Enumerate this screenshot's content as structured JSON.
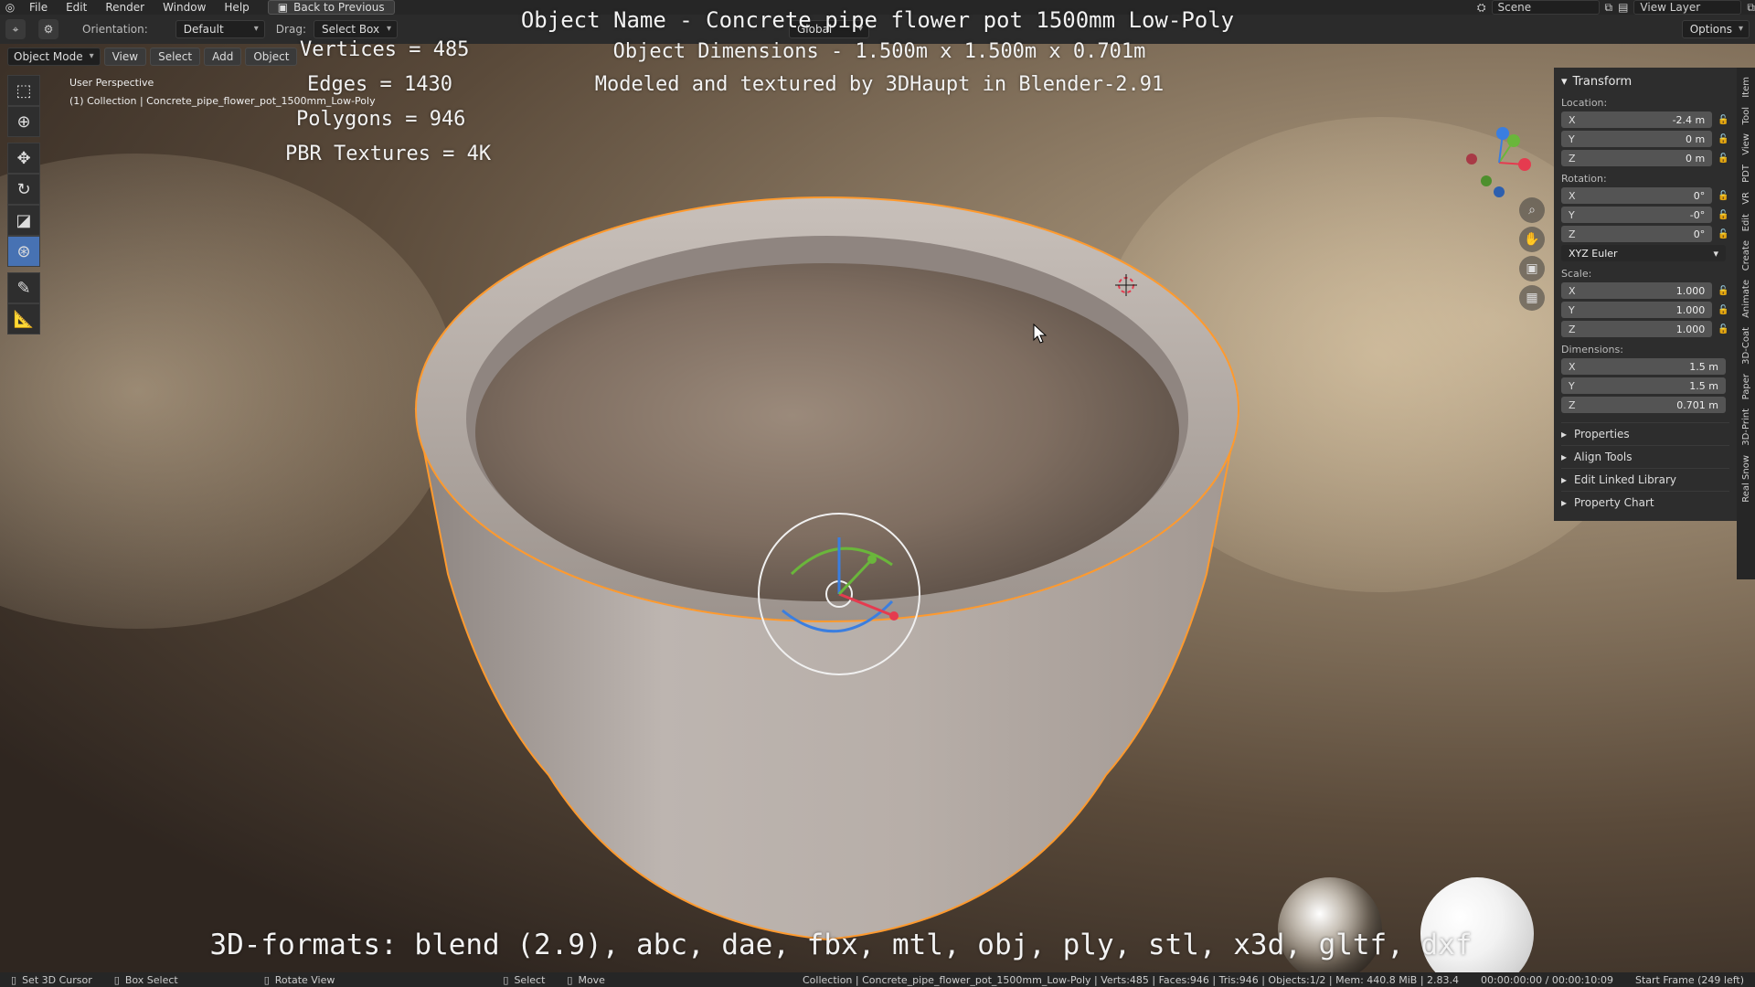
{
  "app": {
    "menu": [
      "File",
      "Edit",
      "Render",
      "Window",
      "Help"
    ],
    "back_button": "Back to Previous",
    "scene_label": "Scene",
    "view_layer_label": "View Layer",
    "options_label": "Options"
  },
  "header": {
    "orientation_label": "Orientation:",
    "orientation_value": "Default",
    "drag_label": "Drag:",
    "drag_value": "Select Box",
    "transform_space": "Global"
  },
  "viewport_header": {
    "mode": "Object Mode",
    "menus": [
      "View",
      "Select",
      "Add",
      "Object"
    ]
  },
  "overlay": {
    "user_perspective": "User Perspective",
    "collection_line": "(1) Collection | Concrete_pipe_flower_pot_1500mm_Low-Poly",
    "stats": {
      "vertices": "Vertices = 485",
      "edges": "Edges = 1430",
      "polygons": "Polygons = 946",
      "pbr": "PBR Textures = 4K"
    },
    "object_name_line": "Object Name - Concrete pipe flower pot 1500mm Low-Poly",
    "object_dimensions_line": "Object Dimensions -  1.500m x 1.500m x 0.701m",
    "modeled_line": "Modeled and textured by 3DHaupt in Blender-2.91",
    "formats_line": "3D-formats: blend (2.9), abc, dae, fbx, mtl, obj, ply, stl, x3d, gltf, dxf"
  },
  "sidebar": {
    "panel_title": "Transform",
    "location": {
      "label": "Location:",
      "x": {
        "axis": "X",
        "value": "-2.4 m"
      },
      "y": {
        "axis": "Y",
        "value": "0 m"
      },
      "z": {
        "axis": "Z",
        "value": "0 m"
      }
    },
    "rotation": {
      "label": "Rotation:",
      "x": {
        "axis": "X",
        "value": "0°"
      },
      "y": {
        "axis": "Y",
        "value": "-0°"
      },
      "z": {
        "axis": "Z",
        "value": "0°"
      },
      "mode": "XYZ Euler"
    },
    "scale": {
      "label": "Scale:",
      "x": {
        "axis": "X",
        "value": "1.000"
      },
      "y": {
        "axis": "Y",
        "value": "1.000"
      },
      "z": {
        "axis": "Z",
        "value": "1.000"
      }
    },
    "dimensions": {
      "label": "Dimensions:",
      "x": {
        "axis": "X",
        "value": "1.5 m"
      },
      "y": {
        "axis": "Y",
        "value": "1.5 m"
      },
      "z": {
        "axis": "Z",
        "value": "0.701 m"
      }
    },
    "subpanels": [
      "Properties",
      "Align Tools",
      "Edit Linked Library",
      "Property Chart"
    ]
  },
  "tabs": [
    "Item",
    "Tool",
    "View",
    "PDT",
    "VR",
    "Edit",
    "Create",
    "Animate",
    "3D-Coat",
    "Paper",
    "3D-Print",
    "Real Snow"
  ],
  "statusbar": {
    "set_cursor": "Set 3D Cursor",
    "box_select": "Box Select",
    "rotate_view": "Rotate View",
    "select": "Select",
    "move": "Move",
    "info": "Collection | Concrete_pipe_flower_pot_1500mm_Low-Poly | Verts:485 | Faces:946 | Tris:946 | Objects:1/2 | Mem: 440.8 MiB | 2.83.4",
    "time": "00:00:00:00 / 00:00:10:09",
    "start_frame": "Start Frame (249 left)"
  },
  "colors": {
    "active_tool": "#4772b3",
    "selection_outline": "#ff9a2e",
    "gizmo_x": "#e53b4f",
    "gizmo_y": "#6ab63b",
    "gizmo_z": "#3a7ee0"
  },
  "icons": {
    "logo": "blender-logo-icon",
    "tools": [
      "select-box-icon",
      "cursor-icon",
      "move-icon",
      "rotate-icon",
      "scale-icon",
      "transform-icon",
      "annotate-icon",
      "measure-icon"
    ]
  }
}
